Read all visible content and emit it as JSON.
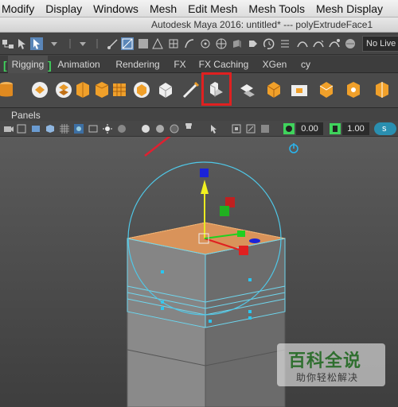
{
  "menubar": {
    "items": [
      "Modify",
      "Display",
      "Windows",
      "Mesh",
      "Edit Mesh",
      "Mesh Tools",
      "Mesh Display"
    ]
  },
  "titlebar": {
    "title": "Autodesk Maya 2016: untitled*   ---   polyExtrudeFace1"
  },
  "statusline": {
    "live_surface": "No Live S"
  },
  "shelf_tabs": {
    "items": [
      "Rigging",
      "Animation",
      "Rendering",
      "FX",
      "FX Caching",
      "XGen",
      "cy"
    ],
    "active": "Rigging",
    "bracket_color": "#3fd35c"
  },
  "shelf": {
    "highlighted_tool": "extrude-icon",
    "highlight_color": "#e02020",
    "icon_color": "#f0a02a"
  },
  "panels": {
    "label": "Panels"
  },
  "viewport_toolbar": {
    "value_a": "0.00",
    "value_b": "1.00",
    "badge": "s"
  },
  "annotation": {
    "arrow_color": "#e02030"
  },
  "watermark": {
    "main": "百科全说",
    "sub": "助你轻松解决"
  }
}
